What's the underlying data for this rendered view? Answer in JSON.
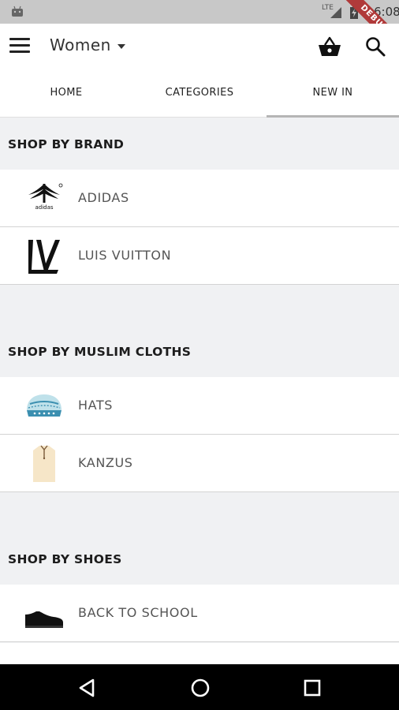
{
  "status_bar": {
    "network": "LTE",
    "time": "6:08"
  },
  "debug_banner": "DEBUG",
  "app_bar": {
    "gender_selector": "Women"
  },
  "tabs": [
    {
      "label": "HOME"
    },
    {
      "label": "CATEGORIES"
    },
    {
      "label": "NEW IN"
    }
  ],
  "sections": [
    {
      "title": "SHOP BY BRAND",
      "items": [
        {
          "label": "ADIDAS",
          "icon": "adidas-logo-icon"
        },
        {
          "label": "LUIS VUITTON",
          "icon": "louis-vuitton-logo-icon"
        }
      ]
    },
    {
      "title": "SHOP BY MUSLIM CLOTHS",
      "items": [
        {
          "label": "HATS",
          "icon": "kufi-hat-icon"
        },
        {
          "label": "KANZUS",
          "icon": "kanzu-robe-icon"
        }
      ]
    },
    {
      "title": "SHOP BY SHOES",
      "items": [
        {
          "label": "BACK TO SCHOOL",
          "icon": "school-shoe-icon"
        }
      ]
    }
  ]
}
